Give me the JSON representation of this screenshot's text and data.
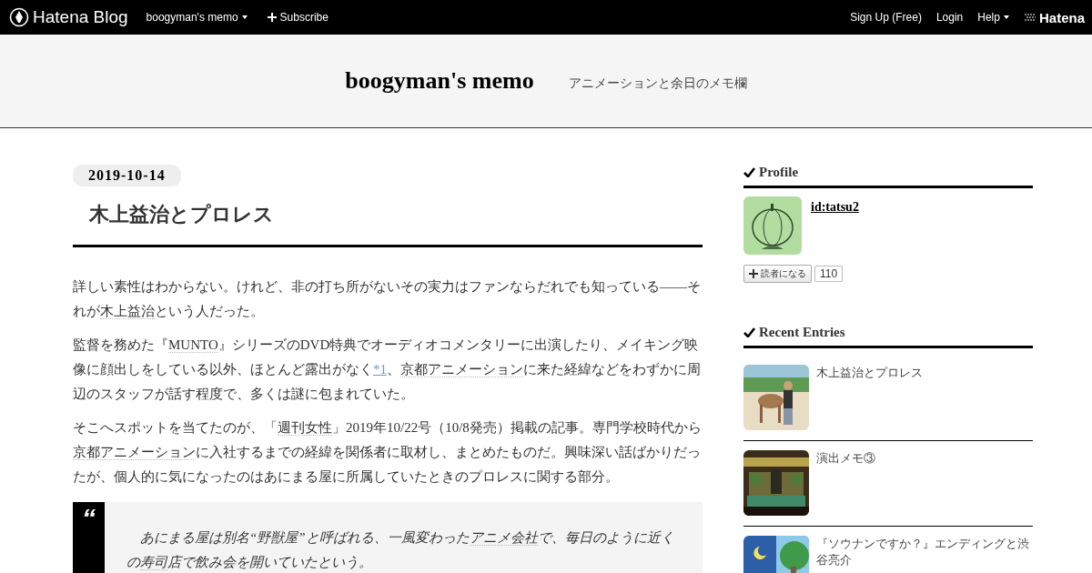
{
  "topbar": {
    "logo": "Hatena Blog",
    "blog_menu": "boogyman's memo",
    "subscribe": "Subscribe",
    "right_links": [
      "Sign Up (Free)",
      "Login"
    ],
    "help": "Help",
    "brand": "Hatena"
  },
  "header": {
    "title": "boogyman's memo",
    "tagline": "アニメーションと余日のメモ欄"
  },
  "entry": {
    "date": "2019-10-14",
    "title": "木上益治とプロレス",
    "paragraphs": [
      [
        {
          "kind": "text",
          "text": "詳しい素性はわからない。けれど、非の打ち所がないその実力はファンならだれでも知っている――それが"
        },
        {
          "kind": "keyword",
          "text": "木上益治"
        },
        {
          "kind": "text",
          "text": "という人だった。"
        }
      ],
      [
        {
          "kind": "text",
          "text": "監督を務めた『"
        },
        {
          "kind": "keyword",
          "text": "MUNTO"
        },
        {
          "kind": "text",
          "text": "』シリーズのDVD特典でオーディオコメンタリーに出演したり、メイキング映像に顔出しをしている以外、ほとんど露出がなく"
        },
        {
          "kind": "footnote",
          "text": "*1"
        },
        {
          "kind": "text",
          "text": "、"
        },
        {
          "kind": "keyword",
          "text": "京都アニメーション"
        },
        {
          "kind": "text",
          "text": "に来た経緯などをわずかに周辺のスタッフが話す程度で、多くは謎に包まれていた。"
        }
      ],
      [
        {
          "kind": "text",
          "text": "そこへスポットを当てたのが、「"
        },
        {
          "kind": "keyword",
          "text": "週刊女性"
        },
        {
          "kind": "text",
          "text": "」2019年10/22号（10/8発売）掲載の記事。専門学校時代から"
        },
        {
          "kind": "keyword",
          "text": "京都アニメーション"
        },
        {
          "kind": "text",
          "text": "に入社するまでの経緯を関係者に取材し、まとめたものだ。興味深い話ばかりだったが、個人的に気になったのはあにまる屋に所属していたときのプロレスに関する部分。"
        }
      ]
    ],
    "quote_mark": "“",
    "quote": [
      {
        "kind": "text",
        "text": "あにまる屋は別名“野獣屋”と呼ばれる、一風変わった"
      },
      {
        "kind": "keyword",
        "text": "アニメ会社"
      },
      {
        "kind": "text",
        "text": "で、毎日のように近くの"
      },
      {
        "kind": "keyword",
        "text": "寿司"
      },
      {
        "kind": "text",
        "text": "店で飲み会を開いていたという。"
      }
    ]
  },
  "sidebar": {
    "profile": {
      "heading": "Profile",
      "user_id": "id:tatsu2",
      "follow": "読者になる",
      "count": "110"
    },
    "recent": {
      "heading": "Recent Entries",
      "items": [
        {
          "title": "木上益治とプロレス",
          "kind": "picture"
        },
        {
          "title": "演出メモ③",
          "kind": "picture"
        },
        {
          "title": "『ソウナンですか？』エンディングと渋谷亮介",
          "kind": "picture"
        }
      ]
    }
  }
}
